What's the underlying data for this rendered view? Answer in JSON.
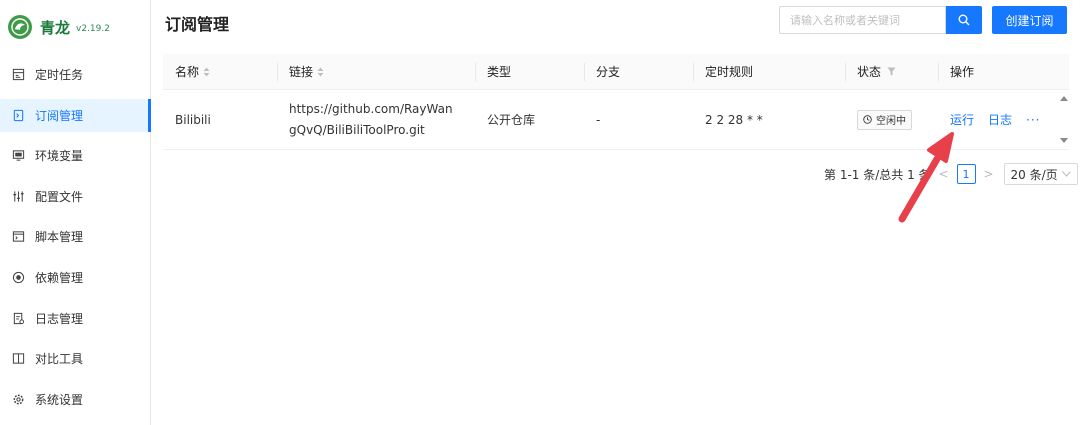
{
  "app": {
    "name": "青龙",
    "version": "v2.19.2"
  },
  "sidebar": {
    "items": [
      {
        "label": "定时任务",
        "icon": "schedule-icon"
      },
      {
        "label": "订阅管理",
        "icon": "subscription-icon",
        "active": true
      },
      {
        "label": "环境变量",
        "icon": "monitor-icon"
      },
      {
        "label": "配置文件",
        "icon": "sliders-icon"
      },
      {
        "label": "脚本管理",
        "icon": "code-window-icon"
      },
      {
        "label": "依赖管理",
        "icon": "dependency-icon"
      },
      {
        "label": "日志管理",
        "icon": "log-file-icon"
      },
      {
        "label": "对比工具",
        "icon": "diff-icon"
      },
      {
        "label": "系统设置",
        "icon": "gear-icon"
      }
    ]
  },
  "header": {
    "title": "订阅管理",
    "search_placeholder": "请输入名称或者关键词",
    "create_label": "创建订阅"
  },
  "table": {
    "columns": [
      "名称",
      "链接",
      "类型",
      "分支",
      "定时规则",
      "状态",
      "操作"
    ],
    "rows": [
      {
        "name": "Bilibili",
        "url": "https://github.com/RayWangQvQ/BiliBiliToolPro.git",
        "type": "公开仓库",
        "branch": "-",
        "schedule": "2 2 28 * *",
        "status": "空闲中",
        "actions": {
          "run": "运行",
          "log": "日志",
          "more": "···"
        }
      }
    ]
  },
  "pagination": {
    "summary": "第 1-1 条/总共 1 条",
    "current_page": "1",
    "page_size": "20 条/页"
  },
  "colors": {
    "accent": "#1677ff",
    "brand": "#3f9a4a",
    "annotation_arrow": "#e8404b"
  }
}
